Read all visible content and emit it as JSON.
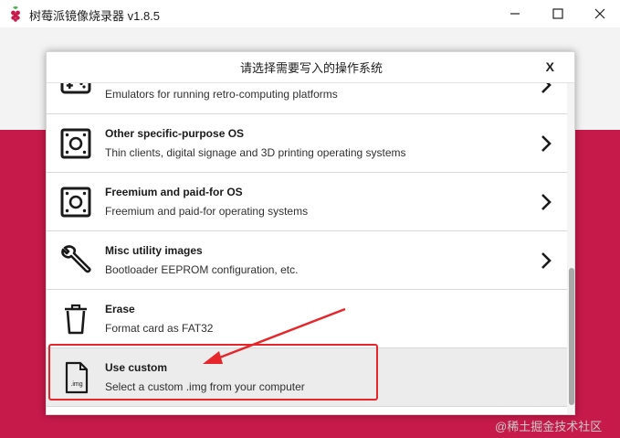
{
  "window": {
    "title": "树莓派镜像烧录器 v1.8.5",
    "icon": "raspberry-icon",
    "controls": [
      "minimize-icon",
      "maximize-icon",
      "close-icon"
    ]
  },
  "colors": {
    "brand_background": "#c51a4a",
    "highlight": "#e6262b",
    "selected_row": "#ececec"
  },
  "dialog": {
    "title": "请选择需要写入的操作系统",
    "close_label": "X",
    "items": [
      {
        "name": "",
        "description": "Emulators for running retro-computing platforms",
        "icon": "gamepad-icon",
        "has_submenu": true
      },
      {
        "name": "Other specific-purpose OS",
        "description": "Thin clients, digital signage and 3D printing operating systems",
        "icon": "board-icon",
        "has_submenu": true
      },
      {
        "name": "Freemium and paid-for OS",
        "description": "Freemium and paid-for operating systems",
        "icon": "board-icon",
        "has_submenu": true
      },
      {
        "name": "Misc utility images",
        "description": "Bootloader EEPROM configuration, etc.",
        "icon": "wrench-icon",
        "has_submenu": true
      },
      {
        "name": "Erase",
        "description": "Format card as FAT32",
        "icon": "trash-icon",
        "has_submenu": false
      },
      {
        "name": "Use custom",
        "description": "Select a custom .img from your computer",
        "icon": "img-file-icon",
        "icon_text": ".img",
        "has_submenu": false,
        "selected": true
      }
    ]
  },
  "watermark": "@稀土掘金技术社区"
}
